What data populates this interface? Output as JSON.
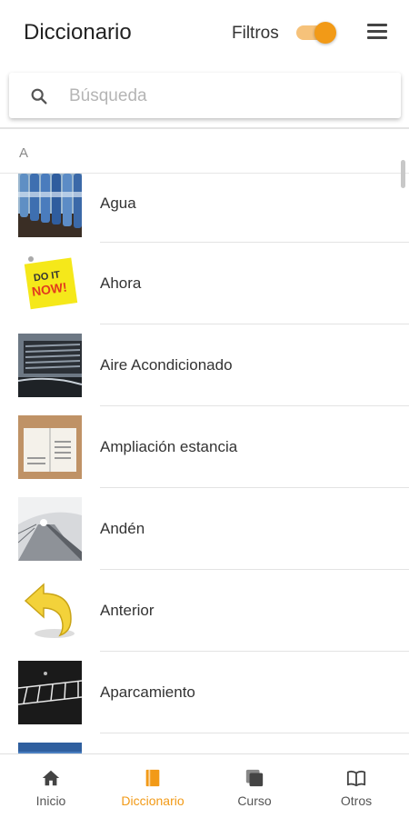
{
  "header": {
    "title": "Diccionario",
    "filters_label": "Filtros",
    "filters_on": true,
    "menu_icon": "hamburger-menu-icon"
  },
  "search": {
    "placeholder": "Búsqueda",
    "value": "",
    "icon": "search-icon"
  },
  "section": {
    "letter": "A"
  },
  "items": [
    {
      "label": "Agua",
      "thumb": "water-bottles-thumbnail"
    },
    {
      "label": "Ahora",
      "thumb": "do-it-now-note-thumbnail"
    },
    {
      "label": "Aire Acondicionado",
      "thumb": "air-vent-thumbnail"
    },
    {
      "label": "Ampliación estancia",
      "thumb": "calendar-notebook-thumbnail"
    },
    {
      "label": "Andén",
      "thumb": "station-platform-thumbnail"
    },
    {
      "label": "Anterior",
      "thumb": "back-arrow-thumbnail"
    },
    {
      "label": "Aparcamiento",
      "thumb": "parking-lot-thumbnail"
    }
  ],
  "bottom_nav": {
    "active": "Diccionario",
    "accent_color": "#f29a17",
    "items": [
      {
        "label": "Inicio",
        "icon": "home-icon"
      },
      {
        "label": "Diccionario",
        "icon": "dictionary-icon"
      },
      {
        "label": "Curso",
        "icon": "course-icon"
      },
      {
        "label": "Otros",
        "icon": "book-icon"
      }
    ]
  }
}
